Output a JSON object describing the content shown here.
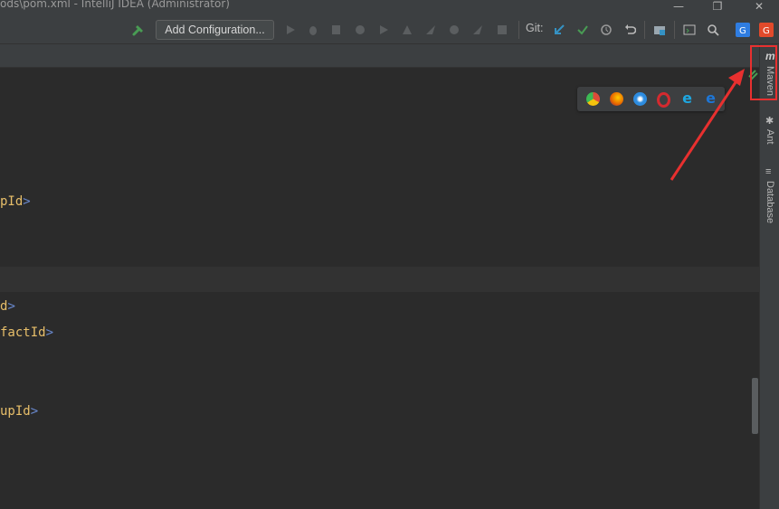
{
  "window": {
    "title": "ods\\pom.xml - IntelliJ IDEA (Administrator)",
    "minimize_glyph": "—",
    "restore_glyph": "❐",
    "close_glyph": "✕"
  },
  "toolbar": {
    "add_configuration_label": "Add Configuration...",
    "git_label": "Git:",
    "icons": [
      "build-hammer-icon",
      "run-icon",
      "debug-icon",
      "coverage-icon",
      "profile-icon",
      "run-alt-icon",
      "attach-icon",
      "deploy-icon",
      "gradle-icon",
      "stop-icon",
      "git-update-icon",
      "git-commit-icon",
      "history-icon",
      "revert-icon",
      "project-structure-icon",
      "terminal-icon",
      "search-icon",
      "translate-icon",
      "google-translate-icon"
    ]
  },
  "editor": {
    "lines": [
      {
        "text": "pId",
        "bracket": ">"
      },
      {
        "text": "d",
        "bracket": ">"
      },
      {
        "text": "factId",
        "bracket": ">"
      },
      {
        "text": "upId",
        "bracket": ">"
      }
    ]
  },
  "right_sidebar": {
    "tabs": [
      {
        "label": "Maven",
        "icon": "maven-icon",
        "glyph": "m"
      },
      {
        "label": "Ant",
        "icon": "ant-icon",
        "glyph": "✱"
      },
      {
        "label": "Database",
        "icon": "database-icon",
        "glyph": "≡"
      }
    ]
  },
  "browser_popup": {
    "browsers": [
      {
        "name": "chrome-icon",
        "color": "#dd4b39"
      },
      {
        "name": "firefox-icon",
        "color": "#e66000"
      },
      {
        "name": "safari-icon",
        "color": "#2d8ce0"
      },
      {
        "name": "opera-icon",
        "color": "#d42a2f"
      },
      {
        "name": "ie-icon",
        "color": "#1ea7e1"
      },
      {
        "name": "edge-icon",
        "color": "#1e76d6"
      }
    ]
  },
  "colors": {
    "accent_red": "#e8302f",
    "xml_tag": "#e8bf6a",
    "xml_bracket": "#6a8ad0",
    "run_green": "#499c54",
    "git_blue": "#3592c4"
  }
}
